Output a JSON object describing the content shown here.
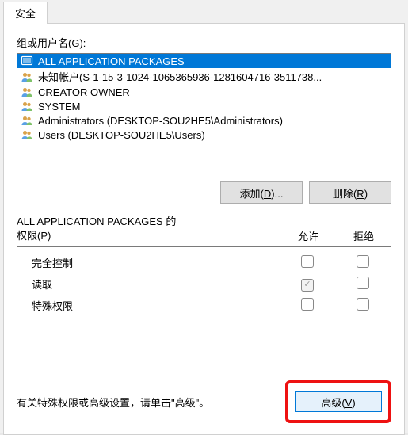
{
  "tab": {
    "label": "安全"
  },
  "groups_label_prefix": "组或用户名(",
  "groups_label_key": "G",
  "groups_label_suffix": "):",
  "principals": [
    {
      "icon": "board",
      "name": "ALL APPLICATION PACKAGES",
      "selected": true
    },
    {
      "icon": "group",
      "name": "未知帐户(S-1-15-3-1024-1065365936-1281604716-3511738...",
      "selected": false
    },
    {
      "icon": "group",
      "name": "CREATOR OWNER",
      "selected": false
    },
    {
      "icon": "group",
      "name": "SYSTEM",
      "selected": false
    },
    {
      "icon": "group",
      "name": "Administrators (DESKTOP-SOU2HE5\\Administrators)",
      "selected": false
    },
    {
      "icon": "group",
      "name": "Users (DESKTOP-SOU2HE5\\Users)",
      "selected": false
    }
  ],
  "buttons": {
    "add_prefix": "添加(",
    "add_key": "D",
    "add_suffix": ")...",
    "remove_prefix": "删除(",
    "remove_key": "R",
    "remove_suffix": ")"
  },
  "perm_title_line1": "ALL APPLICATION PACKAGES 的",
  "perm_title_prefix": "权限(",
  "perm_title_key": "P",
  "perm_title_suffix": ")",
  "columns": {
    "allow": "允许",
    "deny": "拒绝"
  },
  "permissions": [
    {
      "name": "完全控制",
      "allow": false,
      "deny": false,
      "allow_disabled": false
    },
    {
      "name": "读取",
      "allow": true,
      "deny": false,
      "allow_disabled": true
    },
    {
      "name": "特殊权限",
      "allow": false,
      "deny": false,
      "allow_disabled": false
    }
  ],
  "footer_text": "有关特殊权限或高级设置，请单击\"高级\"。",
  "advanced_prefix": "高级(",
  "advanced_key": "V",
  "advanced_suffix": ")"
}
